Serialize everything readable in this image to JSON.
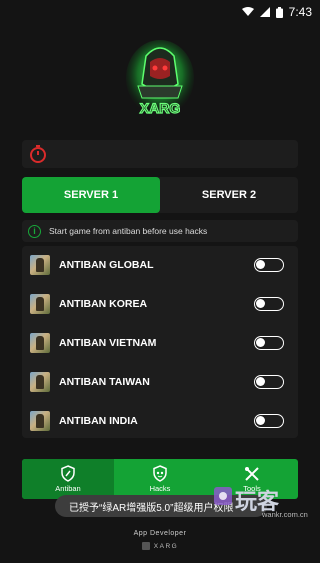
{
  "status_bar": {
    "time": "7:43",
    "icons": [
      "wifi-icon",
      "signal-icon",
      "battery-icon"
    ]
  },
  "app": {
    "logo_text": "XARG",
    "accent_color": "#14a335",
    "timer_color": "#d92b2b"
  },
  "servers": {
    "tabs": [
      {
        "label": "SERVER 1",
        "active": true
      },
      {
        "label": "SERVER 2",
        "active": false
      }
    ]
  },
  "notice": {
    "text": "Start game from antiban before use hacks"
  },
  "antiban_list": [
    {
      "label": "ANTIBAN GLOBAL",
      "on": false
    },
    {
      "label": "ANTIBAN KOREA",
      "on": false
    },
    {
      "label": "ANTIBAN VIETNAM",
      "on": false
    },
    {
      "label": "ANTIBAN TAIWAN",
      "on": false
    },
    {
      "label": "ANTIBAN INDIA",
      "on": false
    }
  ],
  "bottom_nav": {
    "items": [
      {
        "label": "Antiban",
        "icon": "shield-icon"
      },
      {
        "label": "Hacks",
        "icon": "mask-shield-icon"
      },
      {
        "label": "Tools",
        "icon": "tools-icon"
      }
    ]
  },
  "toast": {
    "text": "已授予“绿AR增强版5.0”超级用户权限"
  },
  "watermark": {
    "brand": "玩客",
    "url": "wankr.com.cn"
  },
  "footer": {
    "line1": "App Developer",
    "line2": "XARG"
  }
}
